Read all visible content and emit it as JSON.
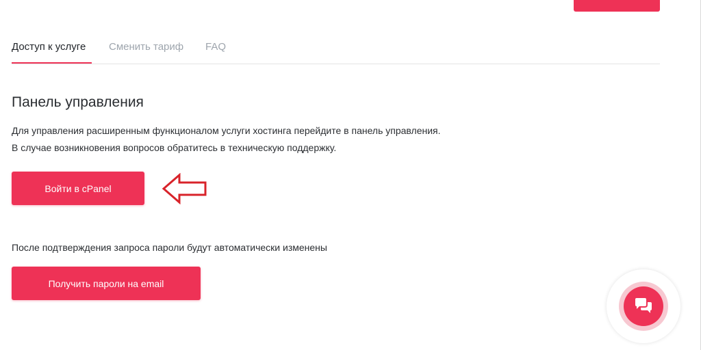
{
  "tabs": [
    {
      "label": "Доступ к услуге",
      "active": true
    },
    {
      "label": "Сменить тариф",
      "active": false
    },
    {
      "label": "FAQ",
      "active": false
    }
  ],
  "panel": {
    "title": "Панель управления",
    "description_line1": "Для управления расширенным функционалом услуги хостинга перейдите в панель управления.",
    "description_line2": "В случае возникновения вопросов обратитесь в техническую поддержку.",
    "cpanel_button": "Войти в cPanel"
  },
  "passwords": {
    "note": "После подтверждения запроса пароли будут автоматически изменены",
    "button": "Получить пароли на email"
  },
  "chat": {
    "icon": "chat-bubbles-icon"
  },
  "colors": {
    "accent": "#ee3256",
    "arrow": "#d8232a",
    "tab_inactive": "#9ea5ad",
    "text": "#2a2d31"
  }
}
